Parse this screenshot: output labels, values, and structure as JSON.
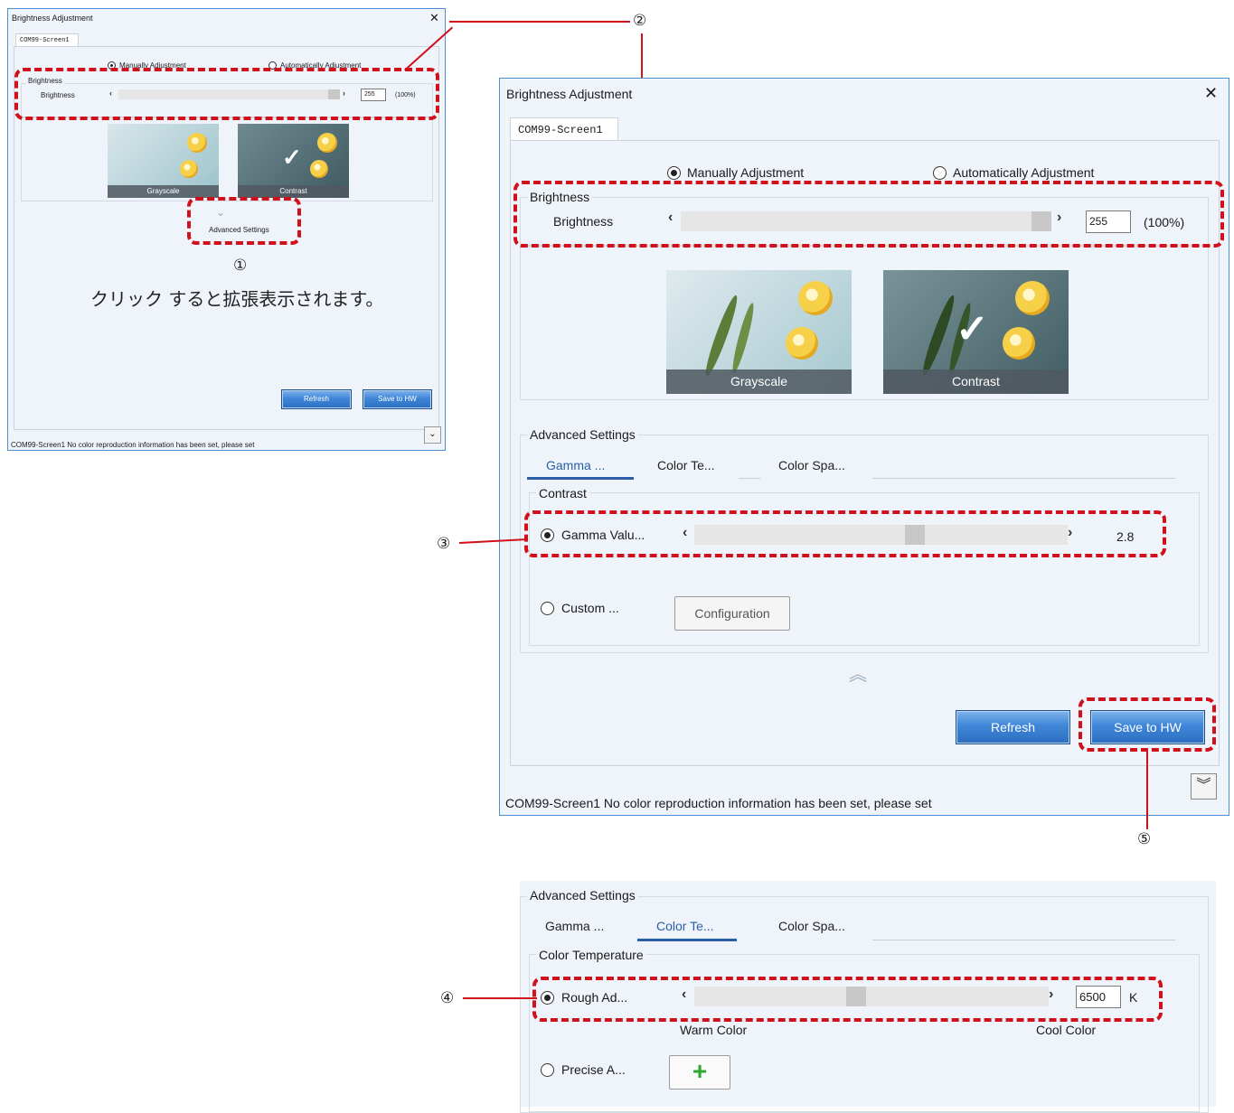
{
  "window": {
    "title": "Brightness Adjustment",
    "close_icon": "close-icon",
    "tab": "COM99-Screen1",
    "mode_manual": "Manually Adjustment",
    "mode_auto": "Automatically Adjustment",
    "brightness_group": "Brightness",
    "brightness_label": "Brightness",
    "brightness_value": "255",
    "brightness_percent": "(100%)",
    "brightness_level": 1.0,
    "preset_grayscale": "Grayscale",
    "preset_contrast": "Contrast",
    "advanced_settings": "Advanced Settings",
    "refresh": "Refresh",
    "save_to_hw": "Save to HW",
    "status": "COM99-Screen1 No color reproduction information has been set, please set"
  },
  "advanced": {
    "tab_gamma": "Gamma ...",
    "tab_color_temp": "Color Te...",
    "tab_color_space": "Color Spa...",
    "contrast_group": "Contrast",
    "gamma_label": "Gamma Valu...",
    "gamma_value": "2.8",
    "custom_label": "Custom ...",
    "configuration": "Configuration",
    "color_temp_group": "Color Temperature",
    "rough_label": "Rough Ad...",
    "temp_value": "6500",
    "temp_unit": "K",
    "warm": "Warm Color",
    "cool": "Cool Color",
    "precise_label": "Precise A..."
  },
  "callouts": {
    "c1": "①",
    "c1_text": "クリック すると拡張表示されます。",
    "c2": "②",
    "c3": "③",
    "c4": "④",
    "c5": "⑤"
  },
  "colors": {
    "annotation_red": "#d0101b",
    "button_blue": "#3f86d8",
    "accent_tab": "#2b5ea8"
  }
}
